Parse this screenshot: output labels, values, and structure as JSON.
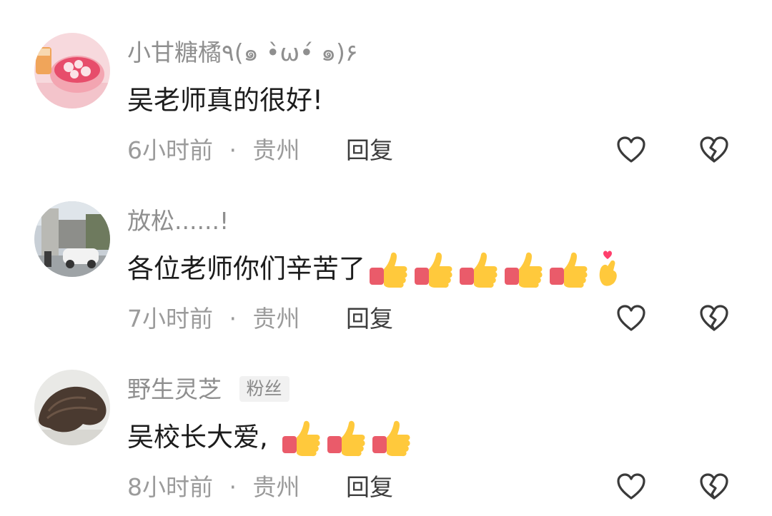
{
  "comments": [
    {
      "username": "小甘糖橘٩(๑ •̀ω•́ ๑)۶",
      "badge": "",
      "text": "吴老师真的很好!",
      "thumbs": 0,
      "crossed_fingers": 0,
      "time": "6小时前",
      "separator": "·",
      "location": "贵州",
      "reply_label": "回复",
      "icons": {
        "like": "heart-outline-icon",
        "dislike": "broken-heart-outline-icon"
      }
    },
    {
      "username": "放松......!",
      "badge": "",
      "text": "各位老师你们辛苦了",
      "thumbs": 5,
      "crossed_fingers": 1,
      "time": "7小时前",
      "separator": "·",
      "location": "贵州",
      "reply_label": "回复",
      "icons": {
        "like": "heart-outline-icon",
        "dislike": "broken-heart-outline-icon"
      }
    },
    {
      "username": "野生灵芝",
      "badge": "粉丝",
      "text": "吴校长大爱,",
      "thumbs": 3,
      "crossed_fingers": 0,
      "time": "8小时前",
      "separator": "·",
      "location": "贵州",
      "reply_label": "回复",
      "icons": {
        "like": "heart-outline-icon",
        "dislike": "broken-heart-outline-icon"
      }
    }
  ],
  "colors": {
    "username": "#8f8f8f",
    "text": "#1c1c1c",
    "meta": "#9b9b9b",
    "reply": "#3d3d3d",
    "icon_stroke": "#3a3a3a",
    "badge_bg": "#f1f1f1"
  }
}
